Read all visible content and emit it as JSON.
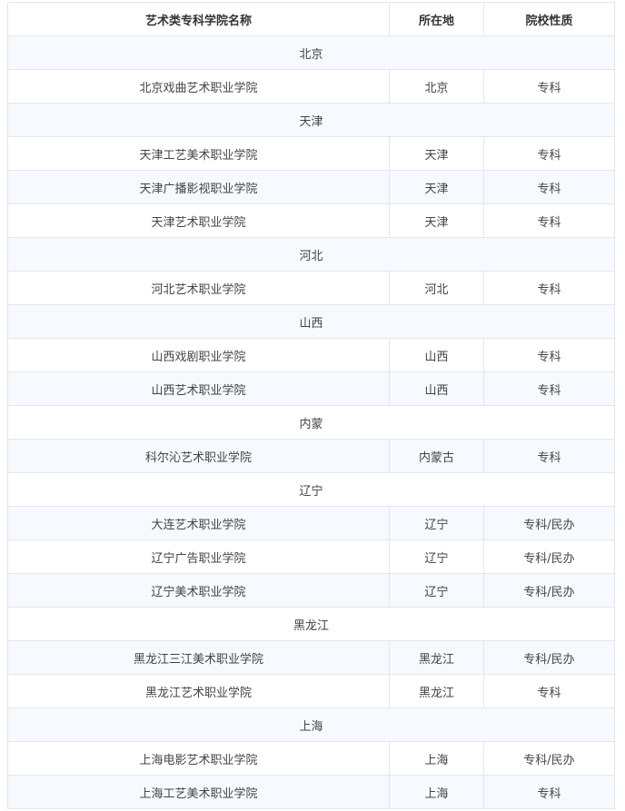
{
  "table": {
    "headers": [
      "艺术类专科学院名称",
      "所在地",
      "院校性质"
    ],
    "rows": [
      {
        "region": "北京"
      },
      {
        "cells": [
          "北京戏曲艺术职业学院",
          "北京",
          "专科"
        ]
      },
      {
        "region": "天津"
      },
      {
        "cells": [
          "天津工艺美术职业学院",
          "天津",
          "专科"
        ]
      },
      {
        "cells": [
          "天津广播影视职业学院",
          "天津",
          "专科"
        ]
      },
      {
        "cells": [
          "天津艺术职业学院",
          "天津",
          "专科"
        ]
      },
      {
        "region": "河北"
      },
      {
        "cells": [
          "河北艺术职业学院",
          "河北",
          "专科"
        ]
      },
      {
        "region": "山西"
      },
      {
        "cells": [
          "山西戏剧职业学院",
          "山西",
          "专科"
        ]
      },
      {
        "cells": [
          "山西艺术职业学院",
          "山西",
          "专科"
        ]
      },
      {
        "region": "内蒙"
      },
      {
        "cells": [
          "科尔沁艺术职业学院",
          "内蒙古",
          "专科"
        ]
      },
      {
        "region": "辽宁"
      },
      {
        "cells": [
          "大连艺术职业学院",
          "辽宁",
          "专科/民办"
        ]
      },
      {
        "cells": [
          "辽宁广告职业学院",
          "辽宁",
          "专科/民办"
        ]
      },
      {
        "cells": [
          "辽宁美术职业学院",
          "辽宁",
          "专科/民办"
        ]
      },
      {
        "region": "黑龙江"
      },
      {
        "cells": [
          "黑龙江三江美术职业学院",
          "黑龙江",
          "专科/民办"
        ]
      },
      {
        "cells": [
          "黑龙江艺术职业学院",
          "黑龙江",
          "专科"
        ]
      },
      {
        "region": "上海"
      },
      {
        "cells": [
          "上海电影艺术职业学院",
          "上海",
          "专科/民办"
        ]
      },
      {
        "cells": [
          "上海工艺美术职业学院",
          "上海",
          "专科"
        ]
      }
    ]
  }
}
